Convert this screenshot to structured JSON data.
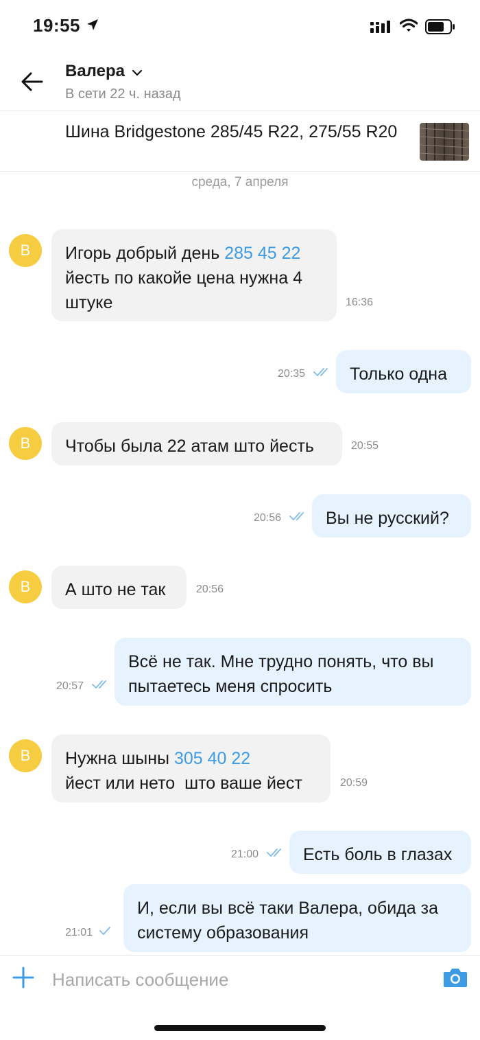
{
  "status_bar": {
    "time": "19:55"
  },
  "header": {
    "contact_name": "Валера",
    "contact_status": "В сети 22 ч. назад",
    "listing_title": "Шина Bridgestone 285/45 R22, 275/55 R20"
  },
  "date_separator": "среда, 7 апреля",
  "messages": [
    {
      "id": "m1",
      "dir": "in",
      "avatar": "В",
      "text_a": "Игорь добрый день ",
      "link": "285 45 22",
      "text_b": "\nйесть по какойе цена нужна 4\nштуке",
      "time": "16:36"
    },
    {
      "id": "m2",
      "dir": "out",
      "text": "Только одна",
      "time": "20:35",
      "ticks": "double"
    },
    {
      "id": "m3",
      "dir": "in",
      "avatar": "В",
      "text": "Чтобы была 22 атам што йесть",
      "time": "20:55"
    },
    {
      "id": "m4",
      "dir": "out",
      "text": "Вы не русский?",
      "time": "20:56",
      "ticks": "double"
    },
    {
      "id": "m5",
      "dir": "in",
      "avatar": "В",
      "text": "А што не так",
      "time": "20:56"
    },
    {
      "id": "m6",
      "dir": "out",
      "text": "Всё не так. Мне трудно понять, что вы\nпытаетесь меня спросить",
      "time": "20:57",
      "ticks": "double"
    },
    {
      "id": "m7",
      "dir": "in",
      "avatar": "В",
      "text_a": "Нужна шыны ",
      "link": "305 40 22",
      "text_b": "\nйест или нето  што ваше йест",
      "time": "20:59"
    },
    {
      "id": "m8",
      "dir": "out",
      "text": "Есть боль в глазах",
      "time": "21:00",
      "ticks": "double"
    },
    {
      "id": "m9",
      "dir": "out",
      "text": "И, если вы всё таки Валера, обида за\nсистему образования",
      "time": "21:01",
      "ticks": "single"
    }
  ],
  "composer": {
    "placeholder": "Написать сообщение"
  },
  "colors": {
    "accent": "#3c9be4",
    "avatar": "#f6cc41",
    "incoming_bubble": "#f2f2f2",
    "outgoing_bubble": "#e6f3fe"
  },
  "icons": [
    "location-arrow-icon",
    "signal-icon",
    "wifi-icon",
    "battery-icon",
    "back-arrow-icon",
    "chevron-down-icon",
    "plus-icon",
    "camera-icon",
    "read-ticks-icon"
  ]
}
